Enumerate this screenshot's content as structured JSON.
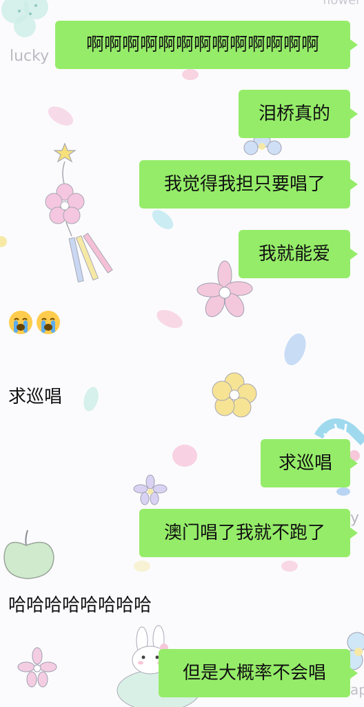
{
  "background": {
    "watermark_left": "lucky",
    "watermark_top_right": "flower",
    "watermark_right_mid": "y",
    "watermark_bottom_right": "ap"
  },
  "messages": [
    {
      "side": "right",
      "text": "啊啊啊啊啊啊啊啊啊啊啊啊啊"
    },
    {
      "side": "right",
      "text": "泪桥真的"
    },
    {
      "side": "right",
      "text": "我觉得我担只要唱了"
    },
    {
      "side": "right",
      "text": "我就能爱"
    },
    {
      "side": "left",
      "type": "emoji",
      "emoji": [
        "loudly-crying-face",
        "loudly-crying-face"
      ]
    },
    {
      "side": "left",
      "text": "求巡唱"
    },
    {
      "side": "right",
      "text": "求巡唱"
    },
    {
      "side": "right",
      "text": "澳门唱了我就不跑了"
    },
    {
      "side": "left",
      "text": "哈哈哈哈哈哈哈哈"
    },
    {
      "side": "right",
      "text": "但是大概率不会唱"
    }
  ],
  "colors": {
    "bubble_green": "#95ec69",
    "text": "#111111",
    "background": "#fbfbfd"
  }
}
